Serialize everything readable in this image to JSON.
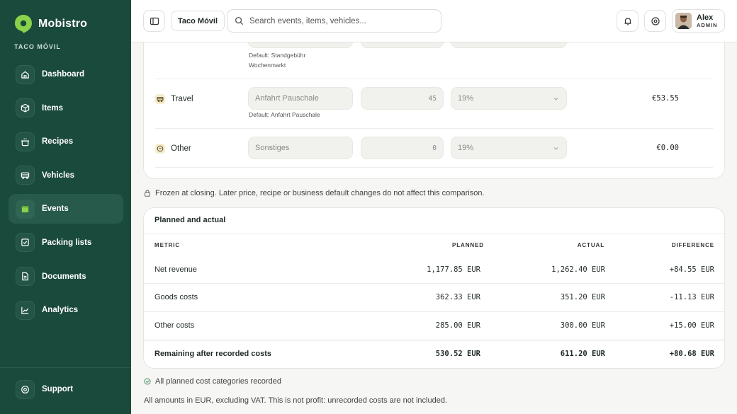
{
  "brand": {
    "name": "Mobistro",
    "org": "TACO MÓVIL"
  },
  "sidebar": {
    "items": [
      {
        "label": "Dashboard",
        "icon": "home-icon"
      },
      {
        "label": "Items",
        "icon": "cube-icon"
      },
      {
        "label": "Recipes",
        "icon": "pot-icon"
      },
      {
        "label": "Vehicles",
        "icon": "truck-icon"
      },
      {
        "label": "Events",
        "icon": "calendar-icon",
        "active": true
      },
      {
        "label": "Packing lists",
        "icon": "checklist-icon"
      },
      {
        "label": "Documents",
        "icon": "document-icon"
      },
      {
        "label": "Analytics",
        "icon": "chart-icon"
      }
    ],
    "support": {
      "label": "Support",
      "icon": "help-circle-icon"
    }
  },
  "topbar": {
    "org_label": "Taco Móvil",
    "search_placeholder": "Search events, items, vehicles...",
    "user": {
      "name": "Alex",
      "role": "ADMIN"
    }
  },
  "expenses": {
    "partial_row": {
      "hint_lines": [
        "Default: Standgebühr",
        "Wochenmarkt"
      ]
    },
    "rows": [
      {
        "category": "Travel",
        "icon": "truck-icon",
        "name_placeholder": "Anfahrt Pauschale",
        "qty": "45",
        "vat": "19%",
        "hint": "Default: Anfahrt Pauschale",
        "amount": "€53.55"
      },
      {
        "category": "Other",
        "icon": "minus-circle-icon",
        "name_placeholder": "Sonstiges",
        "qty": "0",
        "vat": "19%",
        "hint": "",
        "amount": "€0.00"
      }
    ]
  },
  "frozen_note": "Frozen at closing. Later price, recipe or business default changes do not affect this comparison.",
  "comparison": {
    "title": "Planned and actual",
    "headers": {
      "metric": "METRIC",
      "planned": "PLANNED",
      "actual": "ACTUAL",
      "difference": "DIFFERENCE"
    },
    "rows": [
      {
        "metric": "Net revenue",
        "planned": "1,177.85 EUR",
        "actual": "1,262.40 EUR",
        "difference": "+84.55 EUR"
      },
      {
        "metric": "Goods costs",
        "planned": "362.33 EUR",
        "actual": "351.20 EUR",
        "difference": "-11.13 EUR"
      },
      {
        "metric": "Other costs",
        "planned": "285.00 EUR",
        "actual": "300.00 EUR",
        "difference": "+15.00 EUR"
      },
      {
        "metric": "Remaining after recorded costs",
        "planned": "530.52 EUR",
        "actual": "611.20 EUR",
        "difference": "+80.68 EUR",
        "emphasis": true
      }
    ]
  },
  "footer": {
    "status": "All planned cost categories recorded",
    "disclaimer": "All amounts in EUR, excluding VAT. This is not profit: unrecorded costs are not included."
  },
  "colors": {
    "sidebar_bg": "#1a4a3c",
    "brand_green": "#8bd14a",
    "active_item": "#275a4b"
  }
}
